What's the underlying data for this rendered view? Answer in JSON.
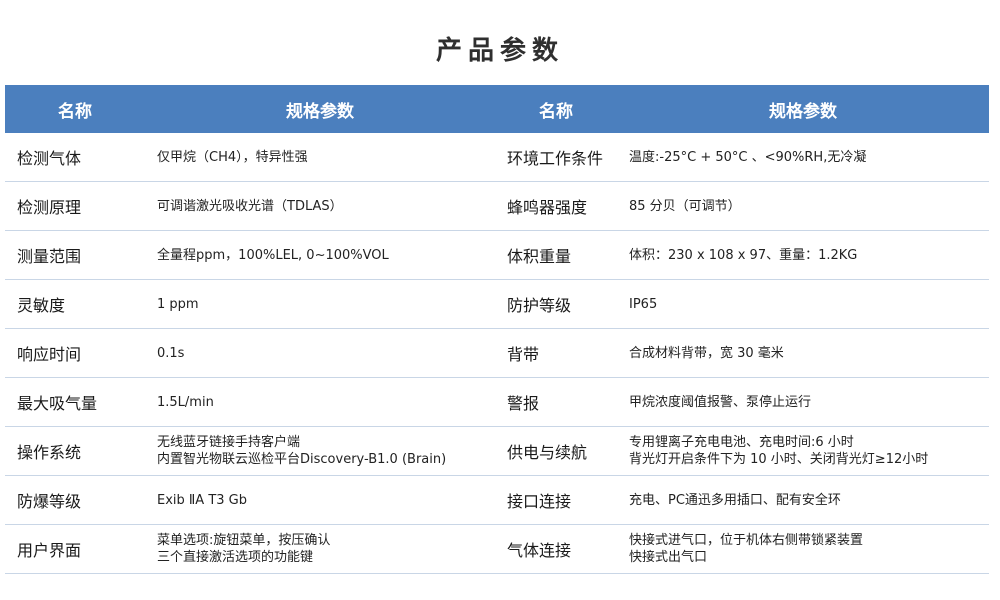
{
  "page": {
    "title": "产品参数"
  },
  "table": {
    "headers": [
      "名称",
      "规格参数",
      "名称",
      "规格参数"
    ],
    "rows": [
      {
        "left_name": "检测气体",
        "left_value": [
          "仅甲烷（CH4），特异性强"
        ],
        "right_name": "环境工作条件",
        "right_value": [
          "温度:-25°C + 50°C 、<90%RH,无冷凝"
        ]
      },
      {
        "left_name": "检测原理",
        "left_value": [
          "可调谐激光吸收光谱（TDLAS）"
        ],
        "right_name": "蜂鸣器强度",
        "right_value": [
          "85 分贝（可调节）"
        ]
      },
      {
        "left_name": "测量范围",
        "left_value": [
          "全量程ppm，100%LEL, 0~100%VOL"
        ],
        "right_name": "体积重量",
        "right_value": [
          "体积：230 x 108 x 97、重量：1.2KG"
        ]
      },
      {
        "left_name": "灵敏度",
        "left_value": [
          "1 ppm"
        ],
        "right_name": "防护等级",
        "right_value": [
          "IP65"
        ]
      },
      {
        "left_name": "响应时间",
        "left_value": [
          "0.1s"
        ],
        "right_name": "背带",
        "right_value": [
          "合成材料背带，宽 30 毫米"
        ]
      },
      {
        "left_name": "最大吸气量",
        "left_value": [
          "1.5L/min"
        ],
        "right_name": "警报",
        "right_value": [
          "甲烷浓度阈值报警、泵停止运行"
        ]
      },
      {
        "left_name": "操作系统",
        "left_value": [
          "无线蓝牙链接手持客户端",
          "内置智光物联云巡检平台Discovery-B1.0 (Brain)"
        ],
        "right_name": "供电与续航",
        "right_value": [
          "专用锂离子充电电池、充电时间:6 小时",
          "背光灯开启条件下为 10 小时、关闭背光灯≥12小时"
        ]
      },
      {
        "left_name": "防爆等级",
        "left_value": [
          "Exib ⅡA T3 Gb"
        ],
        "right_name": "接口连接",
        "right_value": [
          "充电、PC通迅多用插口、配有安全环"
        ]
      },
      {
        "left_name": "用户界面",
        "left_value": [
          "菜单选项:旋钮菜单，按压确认",
          "三个直接激活选项的功能键"
        ],
        "right_name": "气体连接",
        "right_value": [
          "快接式进气口，位于机体右侧带锁紧装置",
          "快接式出气口"
        ]
      }
    ]
  }
}
